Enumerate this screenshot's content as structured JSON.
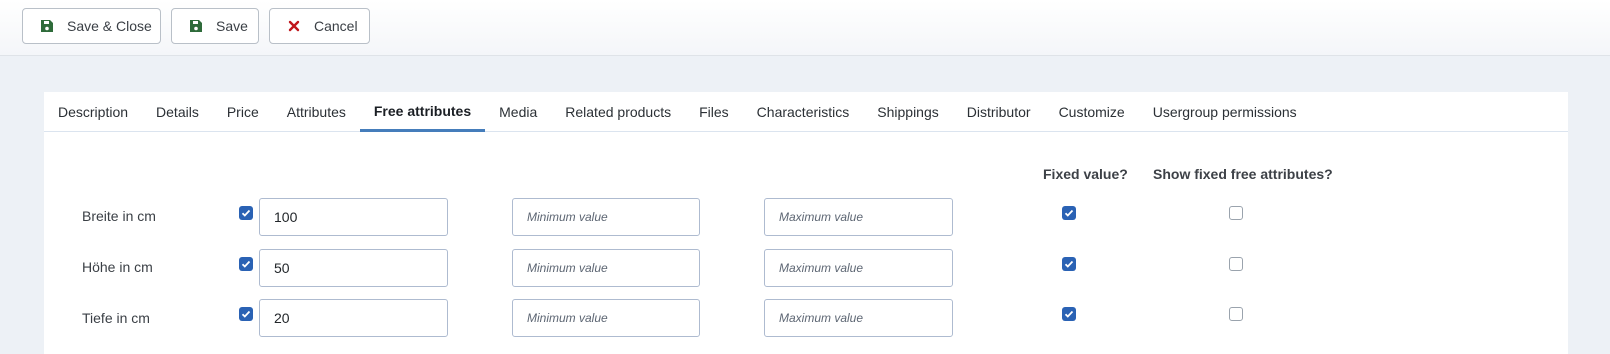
{
  "toolbar": {
    "save_close_label": "Save & Close",
    "save_label": "Save",
    "cancel_label": "Cancel"
  },
  "tabs": [
    {
      "label": "Description",
      "active": false
    },
    {
      "label": "Details",
      "active": false
    },
    {
      "label": "Price",
      "active": false
    },
    {
      "label": "Attributes",
      "active": false
    },
    {
      "label": "Free attributes",
      "active": true
    },
    {
      "label": "Media",
      "active": false
    },
    {
      "label": "Related products",
      "active": false
    },
    {
      "label": "Files",
      "active": false
    },
    {
      "label": "Characteristics",
      "active": false
    },
    {
      "label": "Shippings",
      "active": false
    },
    {
      "label": "Distributor",
      "active": false
    },
    {
      "label": "Customize",
      "active": false
    },
    {
      "label": "Usergroup permissions",
      "active": false
    }
  ],
  "columns": {
    "fixed_value": "Fixed value?",
    "show_fixed": "Show fixed free attributes?"
  },
  "placeholders": {
    "min": "Minimum value",
    "max": "Maximum value"
  },
  "rows": [
    {
      "label": "Breite in cm",
      "enabled": true,
      "value": "100",
      "min": "",
      "max": "",
      "fixed": true,
      "show_fixed": false
    },
    {
      "label": "Höhe in cm",
      "enabled": true,
      "value": "50",
      "min": "",
      "max": "",
      "fixed": true,
      "show_fixed": false
    },
    {
      "label": "Tiefe in cm",
      "enabled": true,
      "value": "20",
      "min": "",
      "max": "",
      "fixed": true,
      "show_fixed": false
    }
  ],
  "colors": {
    "accent": "#2a62b4",
    "save_icon": "#2e6b3a",
    "cancel_icon": "#c0161b"
  }
}
